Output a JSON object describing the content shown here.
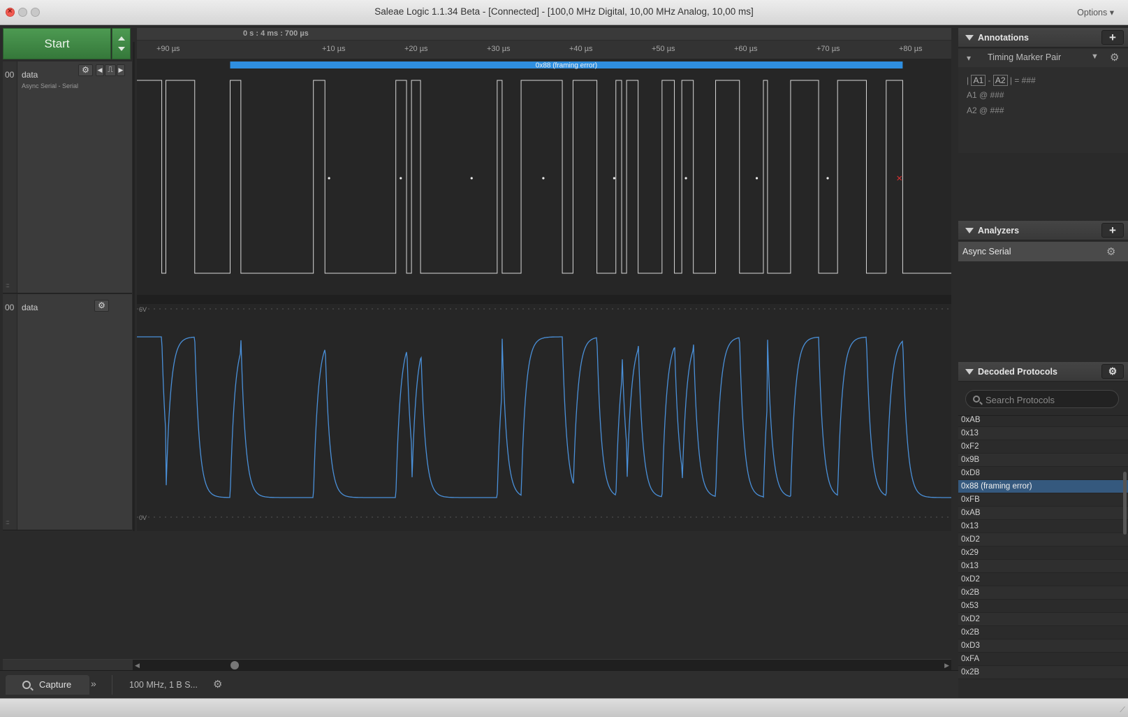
{
  "window": {
    "title": "Saleae Logic 1.1.34 Beta - [Connected] - [100,0 MHz Digital, 10,00 MHz Analog, 10,00 ms]",
    "options_label": "Options ▾"
  },
  "start_button": {
    "label": "Start"
  },
  "channels": [
    {
      "number": "00",
      "name": "data",
      "subtitle": "Async Serial - Serial"
    },
    {
      "number": "00",
      "name": "data",
      "subtitle": ""
    }
  ],
  "timebar": {
    "cursor_time": "0 s : 4 ms : 700 µs"
  },
  "ruler_ticks": [
    "+90 µs",
    "+10 µs",
    "+20 µs",
    "+30 µs",
    "+40 µs",
    "+50 µs",
    "+60 µs",
    "+70 µs",
    "+80 µs"
  ],
  "protocol_bubble": {
    "label": "0x88 (framing error)",
    "color": "#2f8fe0"
  },
  "analog_scale": {
    "top": "6V",
    "bottom": "0V"
  },
  "digital_signal": {
    "levels": [
      1,
      0,
      1,
      0,
      1,
      0,
      1,
      0,
      1,
      0,
      1,
      0,
      1,
      0,
      1,
      0,
      1,
      0,
      1,
      0,
      1,
      0,
      1,
      0,
      1,
      0,
      1,
      0,
      1,
      0,
      1,
      0,
      1,
      0,
      1,
      0,
      1
    ],
    "transition_times_us": [
      -0.4,
      0.1,
      3.6,
      7.9,
      9.2,
      18.0,
      19.4,
      28.0,
      29.3,
      29.9,
      31.0,
      40.3,
      40.9,
      43.2,
      48.2,
      49.5,
      52.4,
      54.7,
      55.4,
      56.0,
      57.4,
      60.3,
      61.8,
      62.7,
      64.1,
      66.8,
      69.7,
      72.6,
      73.1,
      75.9,
      79.3,
      81.6,
      85.1,
      87.5,
      89.5,
      98.6,
      99.2
    ]
  },
  "sample_points_us": [
    19.9,
    28.6,
    37.2,
    45.9,
    54.5,
    63.2,
    71.8,
    80.4
  ],
  "framing_error_point_us": 89.1,
  "analog_signal": {
    "color": "#4a90d9"
  },
  "bottom_tabs": {
    "capture_label": "Capture",
    "more_label": "»",
    "session_label": "100 MHz, 1 B S..."
  },
  "annotations_panel": {
    "title": "Annotations",
    "add_label": "+",
    "timing_marker_label": "Timing Marker Pair",
    "measure_line": "= ###",
    "a1_label": "A1",
    "a2_label": "A2",
    "a1_line": "@  ###",
    "a2_line": "@  ###",
    "separator": "-"
  },
  "analyzers_panel": {
    "title": "Analyzers",
    "add_label": "+",
    "items": [
      "Async Serial"
    ]
  },
  "decoded_panel": {
    "title": "Decoded Protocols",
    "search_placeholder": "Search Protocols",
    "rows": [
      "0xAB",
      "0x13",
      "0xF2",
      "0x9B",
      "0xD8",
      "0x88 (framing error)",
      "0xFB",
      "0xAB",
      "0x13",
      "0xD2",
      "0x29",
      "0x13",
      "0xD2",
      "0x2B",
      "0x53",
      "0xD2",
      "0x2B",
      "0xD3",
      "0xFA",
      "0x2B"
    ],
    "selected_index": 5
  }
}
